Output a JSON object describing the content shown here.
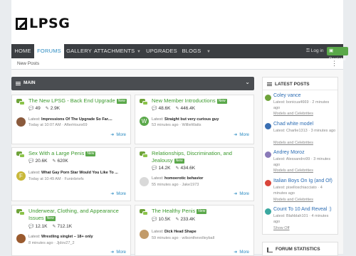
{
  "site": {
    "logo_text": "LPSG"
  },
  "nav": {
    "items": [
      {
        "label": "Home"
      },
      {
        "label": "Forums"
      },
      {
        "label": "Gallery"
      },
      {
        "label": "Attachments"
      },
      {
        "label": "Upgrades"
      },
      {
        "label": "Blogs"
      }
    ],
    "login_label": "Log in",
    "register_label": "Register"
  },
  "subnav": {
    "new_posts": "New Posts",
    "more": "⋮"
  },
  "main_block": {
    "title": "MAIN",
    "toggle": "⌄"
  },
  "new_badge": "New",
  "forums": [
    {
      "title": "The New LPSG - Back End Upgrade",
      "is_new": true,
      "threads": "49",
      "messages": "2.9K",
      "latest_label": "Latest:",
      "latest_title": "Impressions Of The Upgrade So Far....",
      "latest_meta": "Today at 10:07 AM · AfterHours69",
      "more": "More",
      "avatar_color": "#8a5a3c"
    },
    {
      "title": "New Member Introductions",
      "is_new": true,
      "threads": "48.6K",
      "messages": "446.4K",
      "latest_label": "Latest:",
      "latest_title": "Straight but very curious guy",
      "latest_meta": "53 minutes ago · WillieWatts",
      "more": "More",
      "avatar_letter": "W",
      "avatar_color": "#5aa84a"
    },
    {
      "title": "Sex With a Large Penis",
      "is_new": true,
      "threads": "20.6K",
      "messages": "620K",
      "latest_label": "Latest:",
      "latest_title": "What Gay Porn Star Would You Like To ...",
      "latest_meta": "Today at 10:49 AM · Funinbriefs",
      "more": "More",
      "avatar_letter": "F",
      "avatar_color": "#c9b83a"
    },
    {
      "title": "Relationships, Discrimination, and Jealousy",
      "is_new": true,
      "threads": "14.2K",
      "messages": "434.6K",
      "latest_label": "Latest:",
      "latest_title": "homoerotic behavior",
      "latest_meta": "55 minutes ago · Jake1973",
      "more": "More",
      "avatar_color": "#d9d9d9"
    },
    {
      "title": "Underwear, Clothing, and Appearance Issues",
      "is_new": true,
      "threads": "12.1K",
      "messages": "712.1K",
      "latest_label": "Latest:",
      "latest_title": "Wrestling singlet – 18+ only",
      "latest_meta": "8 minutes ago · Jjdov27_2",
      "more": "More",
      "avatar_color": "#9a5a2e"
    },
    {
      "title": "The Healthy Penis",
      "is_new": true,
      "threads": "10.5K",
      "messages": "233.4K",
      "latest_label": "Latest:",
      "latest_title": "Dick Head Shape",
      "latest_meta": "59 minutes ago · wilsonthevolleyball",
      "more": "More",
      "avatar_color": "#c29b6a"
    }
  ],
  "sidebar": {
    "latest_posts_title": "LATEST POSTS",
    "posts": [
      {
        "title": "Coley vance",
        "meta": "Latest: bonicua4669 · 2 minutes ago",
        "forum": "Models and Celebrities",
        "avatar_color": "#6ea33a"
      },
      {
        "title": "Chad white model",
        "meta": "Latest: Charlie1313 · 3 minutes ago",
        "forum": "Models and Celebrities",
        "avatar_color": "#3a6fb3"
      },
      {
        "title": "Andrey Moroz",
        "meta": "Latest: Alessandro99 · 3 minutes ago",
        "forum": "Models and Celebrities",
        "avatar_color": "#8a7ab8"
      },
      {
        "title": "Italian Boys On Ig (and Of)",
        "meta": "Latest: piselloschiacciato · 4 minutes ago",
        "forum": "Models and Celebrities",
        "avatar_color": "#d9453a"
      },
      {
        "title": "Count To 10 And Reveal :)",
        "meta": "Latest: Blahblah101 · 4 minutes ago",
        "forum": "",
        "avatar_color": "#3aa8a0"
      }
    ],
    "show_off": "Show Off",
    "forum_stats_title": "FORUM STATISTICS"
  }
}
